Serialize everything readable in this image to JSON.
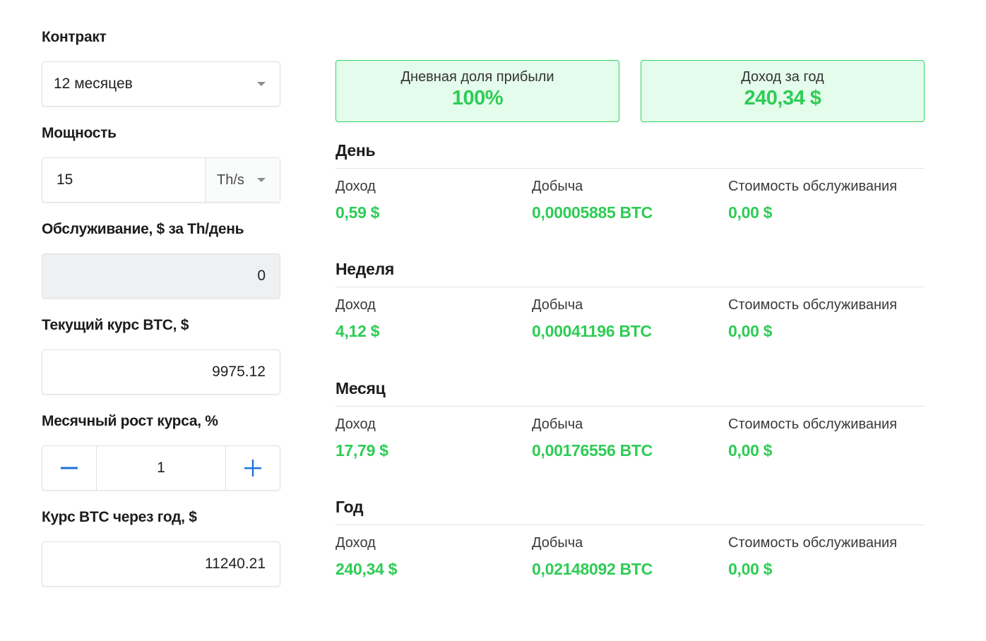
{
  "form": {
    "contract": {
      "label": "Контракт",
      "value": "12 месяцев"
    },
    "power": {
      "label": "Мощность",
      "value": "15",
      "unit": "Th/s"
    },
    "maintenance": {
      "label": "Обслуживание, $ за Th/день",
      "value": "0"
    },
    "btc_rate": {
      "label": "Текущий курс BTC, $",
      "value": "9975.12"
    },
    "monthly_growth": {
      "label": "Месячный рост курса, %",
      "value": "1",
      "minus_icon": "minus-icon",
      "plus_icon": "plus-icon"
    },
    "btc_year_rate": {
      "label": "Курс BTC через год, $",
      "value": "11240.21"
    }
  },
  "summary": {
    "daily_profit_share": {
      "label": "Дневная доля прибыли",
      "value": "100%"
    },
    "yearly_income": {
      "label": "Доход за год",
      "value": "240,34 $"
    }
  },
  "periods": [
    {
      "title": "День",
      "income_label": "Доход",
      "income": "0,59 $",
      "mining_label": "Добыча",
      "mining": "0,00005885 BTC",
      "cost_label": "Стоимость обслуживания",
      "cost": "0,00 $"
    },
    {
      "title": "Неделя",
      "income_label": "Доход",
      "income": "4,12 $",
      "mining_label": "Добыча",
      "mining": "0,00041196 BTC",
      "cost_label": "Стоимость обслуживания",
      "cost": "0,00 $"
    },
    {
      "title": "Месяц",
      "income_label": "Доход",
      "income": "17,79 $",
      "mining_label": "Добыча",
      "mining": "0,00176556 BTC",
      "cost_label": "Стоимость обслуживания",
      "cost": "0,00 $"
    },
    {
      "title": "Год",
      "income_label": "Доход",
      "income": "240,34 $",
      "mining_label": "Добыча",
      "mining": "0,02148092 BTC",
      "cost_label": "Стоимость обслуживания",
      "cost": "0,00 $"
    }
  ],
  "colors": {
    "accent_green": "#2ecc55",
    "card_bg": "#e4fcec",
    "card_border": "#2fd35f",
    "stepper_icon": "#1a73d9"
  }
}
